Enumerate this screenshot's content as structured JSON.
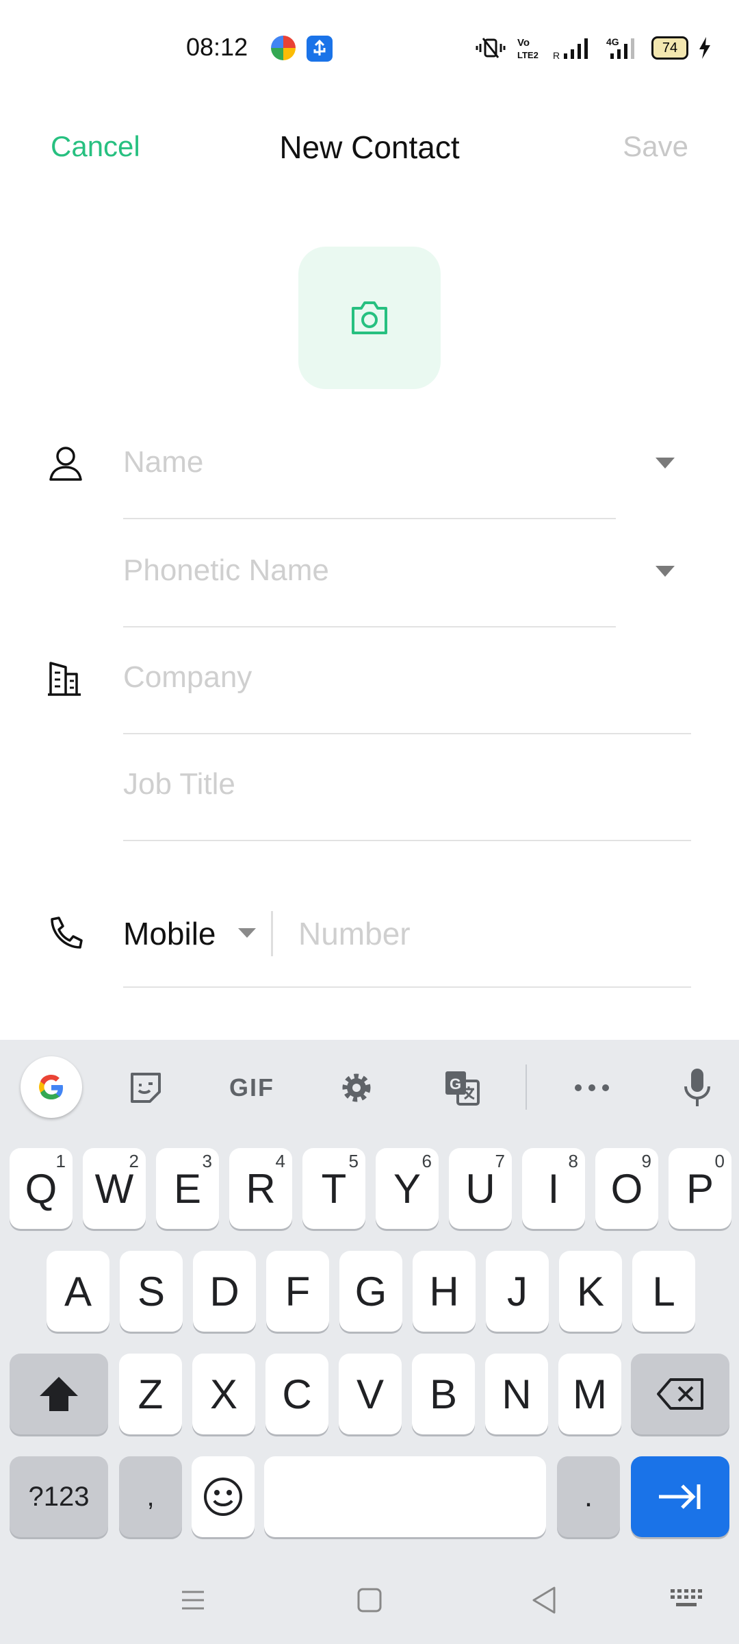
{
  "status_bar": {
    "time": "08:12",
    "battery": "74"
  },
  "header": {
    "cancel_label": "Cancel",
    "title": "New Contact",
    "save_label": "Save"
  },
  "form": {
    "name_placeholder": "Name",
    "phonetic_placeholder": "Phonetic Name",
    "company_placeholder": "Company",
    "job_title_placeholder": "Job Title",
    "phone_type": "Mobile",
    "number_placeholder": "Number"
  },
  "keyboard": {
    "toolbar": {
      "gif_label": "GIF"
    },
    "row1": [
      {
        "key": "Q",
        "hint": "1"
      },
      {
        "key": "W",
        "hint": "2"
      },
      {
        "key": "E",
        "hint": "3"
      },
      {
        "key": "R",
        "hint": "4"
      },
      {
        "key": "T",
        "hint": "5"
      },
      {
        "key": "Y",
        "hint": "6"
      },
      {
        "key": "U",
        "hint": "7"
      },
      {
        "key": "I",
        "hint": "8"
      },
      {
        "key": "O",
        "hint": "9"
      },
      {
        "key": "P",
        "hint": "0"
      }
    ],
    "row2": [
      "A",
      "S",
      "D",
      "F",
      "G",
      "H",
      "J",
      "K",
      "L"
    ],
    "row3": [
      "Z",
      "X",
      "C",
      "V",
      "B",
      "N",
      "M"
    ],
    "symbols_label": "?123",
    "comma": ",",
    "period": "."
  },
  "colors": {
    "accent": "#27c080",
    "keyboard_bg": "#e8eaed",
    "enter_key": "#1a73e8"
  }
}
